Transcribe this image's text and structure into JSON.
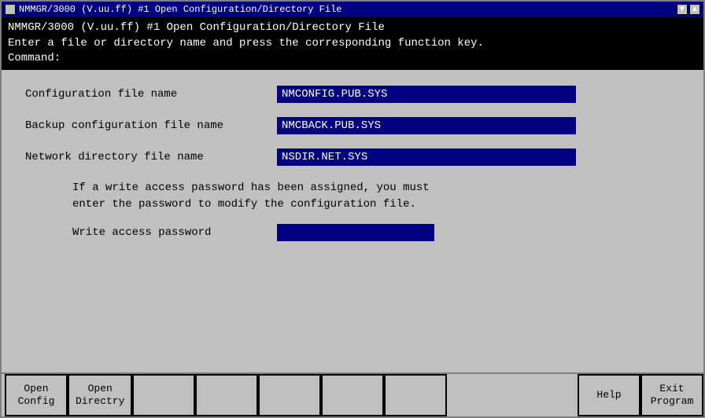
{
  "window": {
    "title": "NMMGR/3000 (V.uu.ff) #1  Open Configuration/Directory File"
  },
  "header": {
    "line1": "NMMGR/3000 (V.uu.ff) #1  Open Configuration/Directory File",
    "line2": "Enter a file or directory name and press the corresponding function key.",
    "line3": "Command:"
  },
  "fields": {
    "config_label": "Configuration file name",
    "config_value": "NMCONFIG.PUB.SYS",
    "backup_label": "Backup configuration file name",
    "backup_value": "NMCBACK.PUB.SYS",
    "network_label": "Network directory file name",
    "network_value": "NSDIR.NET.SYS"
  },
  "password_section": {
    "note_line1": "If a write access password has been assigned, you must",
    "note_line2": "enter the password to modify the configuration file.",
    "label": "Write access password",
    "value": ""
  },
  "bottom_bar": {
    "btn1_line1": "Open",
    "btn1_line2": "Config",
    "btn2_line1": "Open",
    "btn2_line2": "Directry",
    "btn3_line1": "",
    "btn3_line2": "",
    "btn4_line1": "",
    "btn4_line2": "",
    "btn5_line1": "",
    "btn5_line2": "",
    "btn6_line1": "",
    "btn6_line2": "",
    "btn7_line1": "",
    "btn7_line2": "",
    "btn8_line1": "Help",
    "btn8_line2": "",
    "btn9_line1": "Exit",
    "btn9_line2": "Program"
  }
}
